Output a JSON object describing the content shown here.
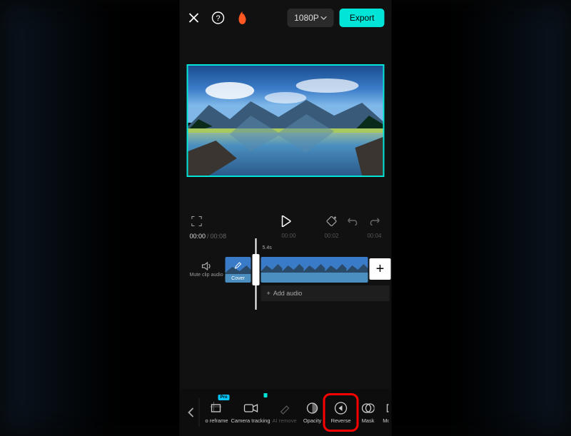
{
  "topbar": {
    "resolution_label": "1080P",
    "export_label": "Export"
  },
  "playback": {
    "current_time": "00:00",
    "separator": "/",
    "total_time": "00:08",
    "ticks": [
      "00:00",
      "00:02",
      "00:04"
    ]
  },
  "timeline": {
    "mute_label": "Mute clip audio",
    "cover_label": "Cover",
    "clip_duration": "5.4s",
    "add_audio_label": "Add audio",
    "add_clip_label": "+",
    "add_audio_plus": "+"
  },
  "tools": {
    "items": [
      {
        "label": "o reframe",
        "badge": "Pro",
        "dim": false
      },
      {
        "label": "Camera tracking",
        "badge": "new",
        "dim": false
      },
      {
        "label": "AI remove",
        "badge": "",
        "dim": true
      },
      {
        "label": "Opacity",
        "badge": "",
        "dim": false
      },
      {
        "label": "Reverse",
        "badge": "",
        "dim": false,
        "highlight": true
      },
      {
        "label": "Mask",
        "badge": "",
        "dim": false
      },
      {
        "label": "Motion",
        "badge": "",
        "dim": false
      }
    ]
  }
}
